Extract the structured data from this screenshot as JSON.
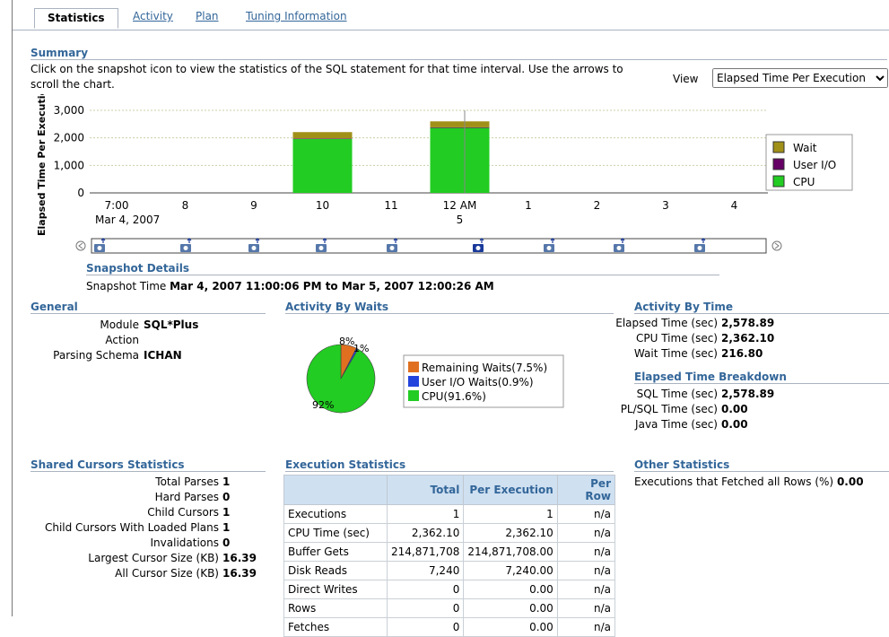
{
  "tabs": [
    {
      "label": "Statistics",
      "active": true
    },
    {
      "label": "Activity"
    },
    {
      "label": "Plan"
    },
    {
      "label": "Tuning Information"
    }
  ],
  "summary": {
    "title": "Summary",
    "description": "Click on the snapshot icon to view the statistics of the SQL statement for that time interval. Use the arrows to scroll the chart.",
    "view_label": "View",
    "view_value": "Elapsed Time Per Execution"
  },
  "chart_data": {
    "type": "bar",
    "ylabel": "Elapsed Time Per Executic",
    "ylim": [
      0,
      3000
    ],
    "yticks": [
      "3,000",
      "2,000",
      "1,000",
      "0"
    ],
    "categories": [
      "7:00",
      "8",
      "9",
      "10",
      "11",
      "12 AM",
      "1",
      "2",
      "3",
      "4"
    ],
    "date_labels": [
      "Mar 4, 2007",
      "5"
    ],
    "series": [
      {
        "name": "Wait",
        "color": "#a09018",
        "values": [
          0,
          0,
          0,
          230,
          0,
          217,
          0,
          0,
          0,
          0
        ]
      },
      {
        "name": "User I/O",
        "color": "#660066",
        "values": [
          0,
          0,
          0,
          20,
          0,
          21,
          0,
          0,
          0,
          0
        ]
      },
      {
        "name": "CPU",
        "color": "#22cc22",
        "values": [
          0,
          0,
          0,
          1960,
          0,
          2362,
          0,
          0,
          0,
          0
        ]
      }
    ],
    "legend_position": "right"
  },
  "snapshot": {
    "title": "Snapshot Details",
    "label": "Snapshot Time",
    "value": "Mar 4, 2007 11:00:06 PM to Mar 5, 2007 12:00:26 AM",
    "icon": "camera-icon"
  },
  "general": {
    "title": "General",
    "module_label": "Module",
    "module_value": "SQL*Plus",
    "action_label": "Action",
    "schema_label": "Parsing Schema",
    "schema_value": "ICHAN"
  },
  "waits": {
    "title": "Activity By Waits",
    "pie": [
      {
        "name": "Remaining Waits(7.5%)",
        "value": 7.5,
        "color": "#e07020",
        "label": "8%"
      },
      {
        "name": "User I/O Waits(0.9%)",
        "value": 0.9,
        "color": "#2244dd",
        "label": "1%"
      },
      {
        "name": "CPU(91.6%)",
        "value": 91.6,
        "color": "#22cc22",
        "label": "92%"
      }
    ]
  },
  "activity_time": {
    "title": "Activity By Time",
    "elapsed_label": "Elapsed Time (sec)",
    "elapsed_value": "2,578.89",
    "cpu_label": "CPU Time (sec)",
    "cpu_value": "2,362.10",
    "wait_label": "Wait Time (sec)",
    "wait_value": "216.80"
  },
  "breakdown": {
    "title": "Elapsed Time Breakdown",
    "sql_label": "SQL Time (sec)",
    "sql_value": "2,578.89",
    "plsql_label": "PL/SQL Time (sec)",
    "plsql_value": "0.00",
    "java_label": "Java Time (sec)",
    "java_value": "0.00"
  },
  "cursors": {
    "title": "Shared Cursors Statistics",
    "rows": [
      {
        "label": "Total Parses",
        "value": "1"
      },
      {
        "label": "Hard Parses",
        "value": "0"
      },
      {
        "label": "Child Cursors",
        "value": "1"
      },
      {
        "label": "Child Cursors With Loaded Plans",
        "value": "1"
      },
      {
        "label": "Invalidations",
        "value": "0"
      },
      {
        "label": "Largest Cursor Size (KB)",
        "value": "16.39"
      },
      {
        "label": "All Cursor Size (KB)",
        "value": "16.39"
      }
    ]
  },
  "execution": {
    "title": "Execution Statistics",
    "headers": [
      "",
      "Total",
      "Per Execution",
      "Per Row"
    ],
    "rows": [
      [
        "Executions",
        "1",
        "1",
        "n/a"
      ],
      [
        "CPU Time (sec)",
        "2,362.10",
        "2,362.10",
        "n/a"
      ],
      [
        "Buffer Gets",
        "214,871,708",
        "214,871,708.00",
        "n/a"
      ],
      [
        "Disk Reads",
        "7,240",
        "7,240.00",
        "n/a"
      ],
      [
        "Direct Writes",
        "0",
        "0.00",
        "n/a"
      ],
      [
        "Rows",
        "0",
        "0.00",
        "n/a"
      ],
      [
        "Fetches",
        "0",
        "0.00",
        "n/a"
      ]
    ]
  },
  "other": {
    "title": "Other Statistics",
    "label": "Executions that Fetched all Rows (%)",
    "value": "0.00"
  }
}
